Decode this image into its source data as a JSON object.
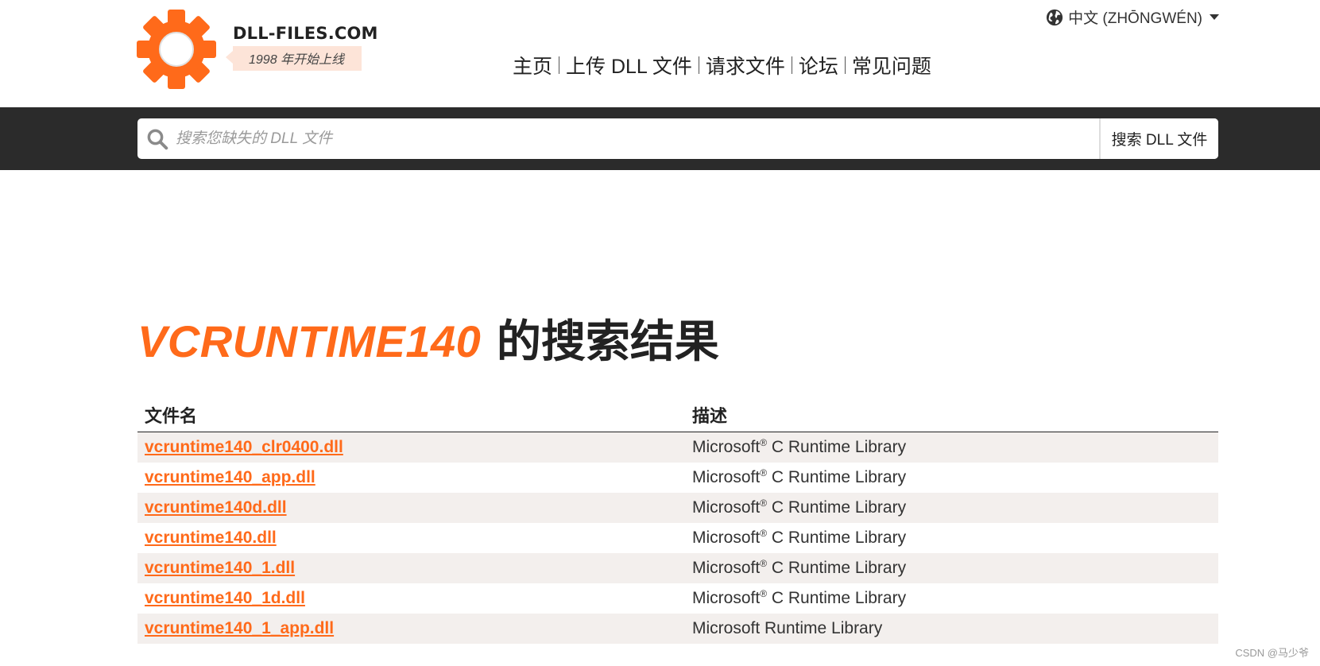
{
  "brand": {
    "name": "DLL-FILES.COM",
    "tagline": "1998 年开始上线",
    "accent": "#ff6a1a"
  },
  "language": {
    "icon": "globe-icon",
    "label": "中文 (ZHŌNGWÉN)"
  },
  "nav": [
    {
      "label": "主页"
    },
    {
      "label": "上传 DLL 文件"
    },
    {
      "label": "请求文件"
    },
    {
      "label": "论坛"
    },
    {
      "label": "常见问题"
    }
  ],
  "search": {
    "placeholder": "搜索您缺失的 DLL 文件",
    "button_label": "搜索 DLL 文件",
    "icon": "search-icon"
  },
  "results": {
    "query": "VCRUNTIME140",
    "title_suffix": " 的搜索结果",
    "columns": [
      "文件名",
      "描述"
    ],
    "rows": [
      {
        "file": "vcruntime140_clr0400.dll",
        "desc_a": "Microsoft",
        "reg": "®",
        "desc_b": " C Runtime Library"
      },
      {
        "file": "vcruntime140_app.dll",
        "desc_a": "Microsoft",
        "reg": "®",
        "desc_b": " C Runtime Library"
      },
      {
        "file": "vcruntime140d.dll",
        "desc_a": "Microsoft",
        "reg": "®",
        "desc_b": " C Runtime Library"
      },
      {
        "file": "vcruntime140.dll",
        "desc_a": "Microsoft",
        "reg": "®",
        "desc_b": " C Runtime Library"
      },
      {
        "file": "vcruntime140_1.dll",
        "desc_a": "Microsoft",
        "reg": "®",
        "desc_b": " C Runtime Library"
      },
      {
        "file": "vcruntime140_1d.dll",
        "desc_a": "Microsoft",
        "reg": "®",
        "desc_b": " C Runtime Library"
      },
      {
        "file": "vcruntime140_1_app.dll",
        "desc_a": "Microsoft Runtime Library",
        "reg": "",
        "desc_b": ""
      }
    ]
  },
  "watermark": "CSDN @马少爷"
}
